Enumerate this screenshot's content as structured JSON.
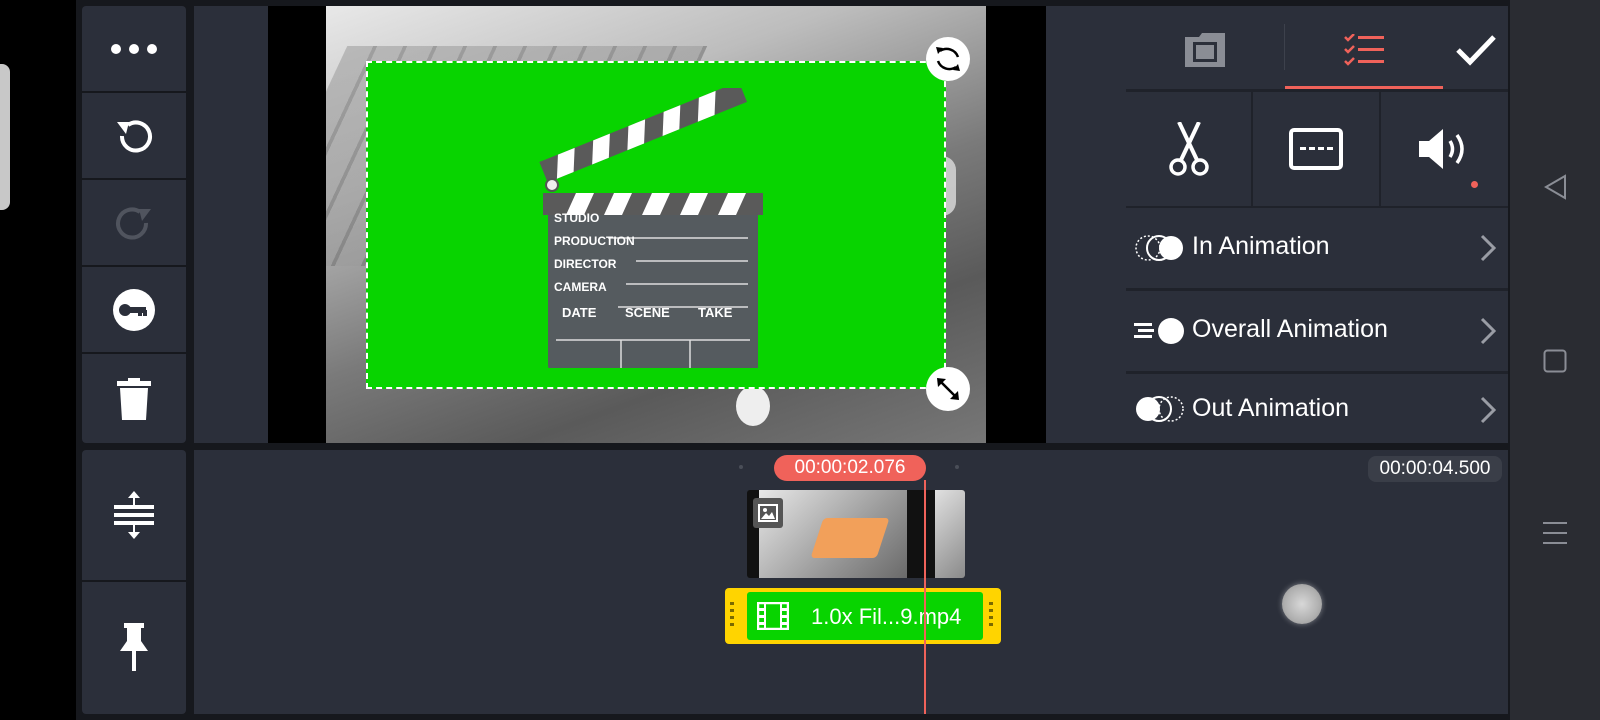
{
  "left_toolbar": {
    "items": [
      {
        "name": "more-icon"
      },
      {
        "name": "undo-icon"
      },
      {
        "name": "redo-icon"
      },
      {
        "name": "key-icon"
      },
      {
        "name": "delete-icon"
      },
      {
        "name": "timeline-resize-icon"
      },
      {
        "name": "pin-icon"
      }
    ]
  },
  "preview": {
    "clapperboard_labels": [
      "STUDIO",
      "PRODUCTION",
      "DIRECTOR",
      "CAMERA"
    ],
    "clapperboard_columns": [
      "DATE",
      "SCENE",
      "TAKE"
    ]
  },
  "right_panel": {
    "tabs": [
      {
        "icon": "media-icon",
        "active": false
      },
      {
        "icon": "options-list-icon",
        "active": true
      },
      {
        "icon": "checkmark-icon",
        "active": false
      }
    ],
    "tools": [
      {
        "icon": "scissors-icon"
      },
      {
        "icon": "subtitle-icon"
      },
      {
        "icon": "volume-icon"
      }
    ],
    "animations": [
      {
        "label": "In Animation"
      },
      {
        "label": "Overall Animation"
      },
      {
        "label": "Out Animation"
      }
    ]
  },
  "timeline": {
    "current_time": "00:00:02.076",
    "total_time": "00:00:04.500",
    "layer_clip_label": "1.0x Fil...9.mp4"
  },
  "colors": {
    "accent": "#f0625a",
    "chroma_green": "#08d400",
    "clip_yellow": "#ffd400",
    "panel": "#2b2f3a",
    "background": "#16181d"
  }
}
